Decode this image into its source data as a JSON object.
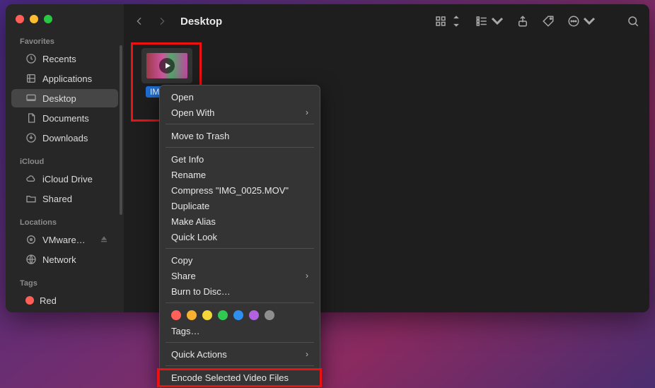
{
  "window": {
    "title": "Desktop"
  },
  "sidebar": {
    "sections": {
      "favorites": {
        "title": "Favorites"
      },
      "icloud": {
        "title": "iCloud"
      },
      "locations": {
        "title": "Locations"
      },
      "tags": {
        "title": "Tags"
      }
    },
    "items": {
      "recents": "Recents",
      "applications": "Applications",
      "desktop": "Desktop",
      "documents": "Documents",
      "downloads": "Downloads",
      "icloud_drive": "iCloud Drive",
      "shared": "Shared",
      "vmware": "VMware…",
      "network": "Network",
      "red": "Red"
    }
  },
  "file": {
    "name": "IMG_0025.MOV",
    "label_truncated": "IMG_0…"
  },
  "context_menu": {
    "open": "Open",
    "open_with": "Open With",
    "move_to_trash": "Move to Trash",
    "get_info": "Get Info",
    "rename": "Rename",
    "compress": "Compress \"IMG_0025.MOV\"",
    "duplicate": "Duplicate",
    "make_alias": "Make Alias",
    "quick_look": "Quick Look",
    "copy": "Copy",
    "share": "Share",
    "burn": "Burn to Disc…",
    "tags": "Tags…",
    "quick_actions": "Quick Actions",
    "encode": "Encode Selected Video Files"
  },
  "tag_colors": [
    "#ff6059",
    "#f8b12e",
    "#f5d63a",
    "#30c952",
    "#2f8fef",
    "#b062e0",
    "#8e8e8e"
  ]
}
